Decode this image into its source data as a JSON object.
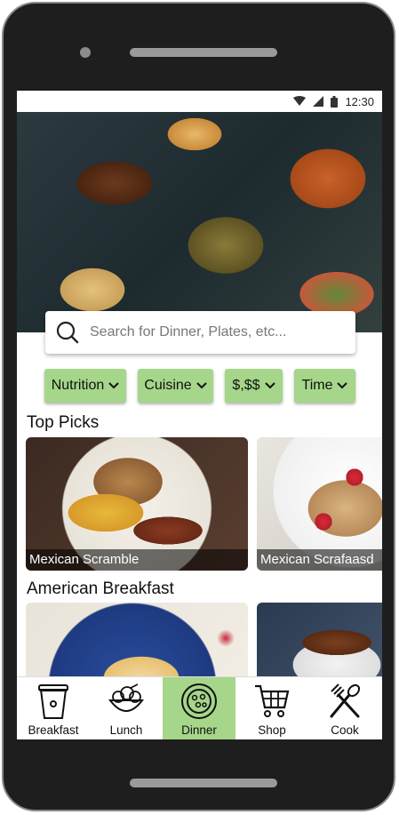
{
  "status_bar": {
    "time": "12:30",
    "icons": [
      "wifi-icon",
      "signal-icon",
      "battery-icon"
    ]
  },
  "search": {
    "placeholder": "Search for Dinner, Plates, etc...",
    "icon": "search-icon"
  },
  "filters": [
    {
      "label": "Nutrition"
    },
    {
      "label": "Cuisine"
    },
    {
      "label": "$,$$"
    },
    {
      "label": "Time"
    }
  ],
  "sections": [
    {
      "title": "Top Picks",
      "cards": [
        {
          "label": "Mexican Scramble"
        },
        {
          "label": "Mexican Scrafaasd"
        }
      ]
    },
    {
      "title": "American Breakfast",
      "cards": [
        {
          "label": ""
        },
        {
          "label": ""
        }
      ]
    }
  ],
  "nav": [
    {
      "label": "Breakfast",
      "icon": "coffee-cup-icon",
      "active": false
    },
    {
      "label": "Lunch",
      "icon": "salad-bowl-icon",
      "active": false
    },
    {
      "label": "Dinner",
      "icon": "dinner-plate-icon",
      "active": true
    },
    {
      "label": "Shop",
      "icon": "shopping-cart-icon",
      "active": false
    },
    {
      "label": "Cook",
      "icon": "utensils-icon",
      "active": false
    }
  ],
  "colors": {
    "accent": "#a5d68a",
    "phone_body": "#1e1e1e"
  }
}
